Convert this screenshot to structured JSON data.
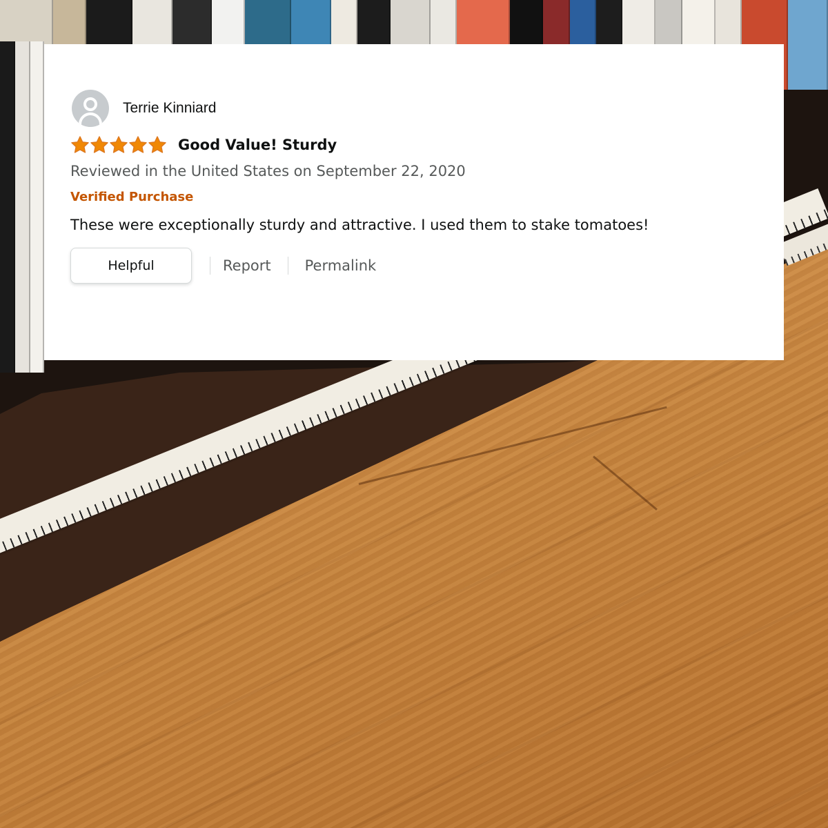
{
  "review": {
    "reviewer_name": "Terrie Kinniard",
    "avatar_icon": "default-user-avatar-icon",
    "rating": 5,
    "rating_max": 5,
    "star_color": "#f08804",
    "title": "Good Value! Sturdy",
    "date_line": "Reviewed in the United States on September 22, 2020",
    "verified_label": "Verified Purchase",
    "verified_color": "#c45500",
    "body": "These were exceptionally sturdy and attractive. I used them to stake tomatoes!"
  },
  "actions": {
    "helpful_label": "Helpful",
    "report_label": "Report",
    "permalink_label": "Permalink"
  }
}
